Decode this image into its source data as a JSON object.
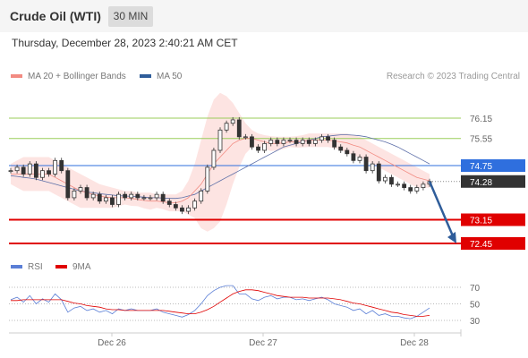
{
  "header": {
    "title": "Crude Oil (WTI)",
    "interval": "30 MIN",
    "timestamp": "Thursday, December 28, 2023 2:40:21 AM CET"
  },
  "legend": {
    "ma20": {
      "label": "MA 20 + Bollinger Bands",
      "color": "#f28b82"
    },
    "ma50": {
      "label": "MA 50",
      "color": "#2f5d9a"
    },
    "rsi": {
      "label": "RSI",
      "color": "#5b7fd6"
    },
    "ma9": {
      "label": "9MA",
      "color": "#e00000"
    }
  },
  "credit": "Research © 2023 Trading Central",
  "chart_data": [
    {
      "type": "line",
      "title": "",
      "ylim": [
        72.25,
        76.6
      ],
      "x_ticks": [
        "Dec 26",
        "Dec 27",
        "Dec 28"
      ],
      "levels": [
        {
          "value": 76.15,
          "label": "76.15",
          "style": "resistance",
          "color": "#9acd5a"
        },
        {
          "value": 75.55,
          "label": "75.55",
          "style": "resistance",
          "color": "#9acd5a"
        },
        {
          "value": 74.75,
          "label": "74.75",
          "style": "pivot",
          "color": "#2f6fde"
        },
        {
          "value": 74.28,
          "label": "74.28",
          "style": "last",
          "color": "#333333"
        },
        {
          "value": 73.15,
          "label": "73.15",
          "style": "support",
          "color": "#e00000"
        },
        {
          "value": 72.45,
          "label": "72.45",
          "style": "support",
          "color": "#e00000"
        }
      ],
      "price": [
        74.6,
        74.7,
        74.5,
        74.8,
        74.4,
        74.6,
        74.5,
        74.9,
        74.6,
        73.8,
        74.0,
        74.1,
        73.8,
        73.9,
        73.7,
        73.8,
        73.6,
        73.9,
        73.8,
        73.9,
        73.8,
        73.8,
        73.8,
        73.9,
        73.7,
        73.6,
        73.5,
        73.4,
        73.5,
        73.7,
        74.0,
        74.7,
        75.2,
        75.8,
        76.0,
        76.1,
        75.6,
        75.6,
        75.3,
        75.2,
        75.4,
        75.5,
        75.4,
        75.5,
        75.5,
        75.4,
        75.5,
        75.4,
        75.5,
        75.6,
        75.5,
        75.3,
        75.2,
        75.1,
        74.9,
        75.0,
        74.6,
        74.8,
        74.3,
        74.4,
        74.2,
        74.2,
        74.1,
        74.0,
        74.1,
        74.2,
        74.28
      ],
      "ma20": [
        74.5,
        74.5,
        74.5,
        74.5,
        74.5,
        74.5,
        74.5,
        74.4,
        74.3,
        74.2,
        74.1,
        74.0,
        73.95,
        73.9,
        73.85,
        73.82,
        73.8,
        73.8,
        73.8,
        73.78,
        73.75,
        73.72,
        73.7,
        73.7,
        73.68,
        73.65,
        73.65,
        73.7,
        73.8,
        74.0,
        74.2,
        74.5,
        74.8,
        75.0,
        75.2,
        75.4,
        75.5,
        75.55,
        75.55,
        75.5,
        75.45,
        75.4,
        75.4,
        75.42,
        75.45,
        75.45,
        75.47,
        75.5,
        75.5,
        75.5,
        75.5,
        75.48,
        75.45,
        75.42,
        75.35,
        75.3,
        75.2,
        75.1,
        75.0,
        74.9,
        74.8,
        74.7,
        74.6,
        74.5,
        74.4,
        74.35,
        74.3
      ],
      "bb_upper": [
        74.8,
        74.9,
        75.0,
        75.0,
        75.0,
        75.0,
        75.0,
        74.9,
        74.8,
        74.7,
        74.6,
        74.5,
        74.4,
        74.3,
        74.2,
        74.15,
        74.1,
        74.05,
        74.0,
        74.0,
        73.95,
        73.95,
        73.95,
        73.9,
        73.9,
        73.9,
        73.9,
        74.0,
        74.3,
        74.8,
        75.5,
        76.2,
        76.7,
        76.9,
        76.8,
        76.6,
        76.3,
        76.0,
        75.8,
        75.7,
        75.65,
        75.62,
        75.6,
        75.6,
        75.6,
        75.62,
        75.65,
        75.7,
        75.7,
        75.7,
        75.7,
        75.7,
        75.7,
        75.7,
        75.65,
        75.6,
        75.5,
        75.4,
        75.3,
        75.2,
        75.1,
        75.0,
        74.9,
        74.8,
        74.7,
        74.6,
        74.5
      ],
      "bb_lower": [
        74.2,
        74.1,
        74.0,
        74.0,
        74.0,
        74.0,
        74.0,
        73.9,
        73.8,
        73.7,
        73.6,
        73.5,
        73.5,
        73.5,
        73.5,
        73.5,
        73.5,
        73.55,
        73.6,
        73.56,
        73.55,
        73.49,
        73.45,
        73.5,
        73.46,
        73.4,
        73.4,
        73.4,
        73.3,
        73.2,
        72.9,
        72.8,
        72.9,
        73.1,
        73.6,
        74.2,
        74.7,
        75.1,
        75.3,
        75.3,
        75.25,
        75.18,
        75.2,
        75.24,
        75.3,
        75.28,
        75.29,
        75.3,
        75.3,
        75.3,
        75.3,
        75.26,
        75.2,
        75.14,
        75.05,
        75.0,
        74.9,
        74.8,
        74.7,
        74.6,
        74.5,
        74.4,
        74.3,
        74.2,
        74.1,
        74.1,
        74.1
      ],
      "ma50": [
        74.45,
        74.43,
        74.4,
        74.38,
        74.35,
        74.3,
        74.25,
        74.2,
        74.15,
        74.1,
        74.05,
        74.0,
        73.97,
        73.95,
        73.92,
        73.9,
        73.88,
        73.86,
        73.85,
        73.84,
        73.83,
        73.82,
        73.8,
        73.8,
        73.79,
        73.78,
        73.78,
        73.8,
        73.85,
        73.9,
        74.0,
        74.1,
        74.2,
        74.3,
        74.4,
        74.5,
        74.6,
        74.7,
        74.8,
        74.9,
        75.0,
        75.1,
        75.2,
        75.3,
        75.35,
        75.4,
        75.45,
        75.5,
        75.55,
        75.6,
        75.62,
        75.64,
        75.66,
        75.66,
        75.65,
        75.63,
        75.6,
        75.55,
        75.5,
        75.45,
        75.38,
        75.3,
        75.2,
        75.1,
        75.0,
        74.9,
        74.8
      ],
      "forecast": {
        "from": 74.28,
        "to": 72.45
      }
    },
    {
      "type": "line",
      "title": "",
      "ylim": [
        20,
        80
      ],
      "y_ticks": [
        70,
        50,
        30
      ],
      "series": [
        {
          "name": "RSI",
          "values": [
            55,
            58,
            52,
            60,
            50,
            56,
            52,
            62,
            55,
            40,
            45,
            47,
            42,
            44,
            40,
            42,
            38,
            44,
            42,
            44,
            42,
            42,
            42,
            44,
            40,
            38,
            36,
            34,
            37,
            42,
            50,
            60,
            66,
            70,
            72,
            72,
            62,
            62,
            56,
            54,
            58,
            60,
            56,
            58,
            58,
            55,
            56,
            54,
            56,
            58,
            55,
            50,
            48,
            46,
            42,
            44,
            38,
            42,
            36,
            38,
            35,
            35,
            33,
            32,
            35,
            40,
            45
          ]
        },
        {
          "name": "9MA",
          "values": [
            54,
            54,
            55,
            55,
            55,
            55,
            55,
            55,
            55,
            53,
            51,
            50,
            48,
            47,
            46,
            44,
            43,
            43,
            42,
            42,
            42,
            42,
            42,
            42,
            42,
            41,
            40,
            39,
            38,
            38,
            40,
            43,
            47,
            52,
            57,
            62,
            65,
            67,
            67,
            66,
            64,
            62,
            60,
            59,
            58,
            58,
            58,
            57,
            57,
            57,
            57,
            56,
            55,
            53,
            51,
            50,
            48,
            46,
            44,
            42,
            40,
            39,
            37,
            36,
            35,
            35,
            36
          ]
        }
      ]
    }
  ]
}
